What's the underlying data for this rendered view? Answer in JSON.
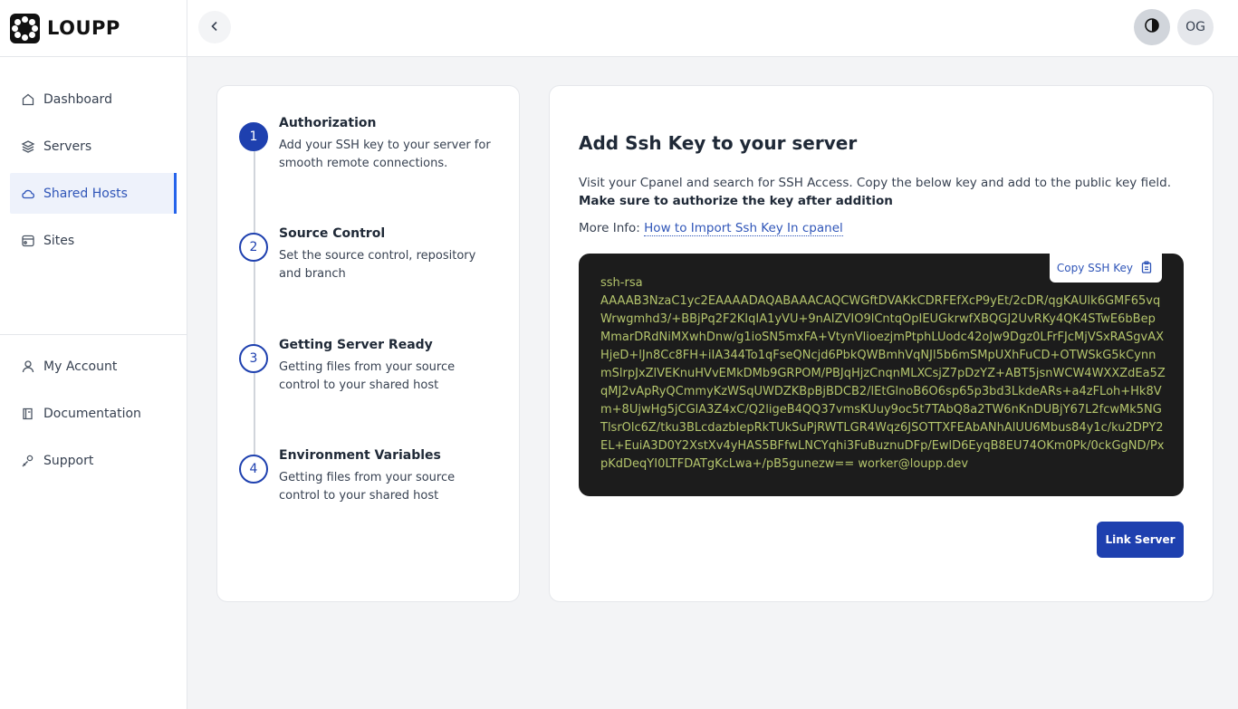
{
  "brand": {
    "name": "LOUPP"
  },
  "sidebar": {
    "items": [
      {
        "label": "Dashboard",
        "icon": "home-icon"
      },
      {
        "label": "Servers",
        "icon": "layers-icon"
      },
      {
        "label": "Shared Hosts",
        "icon": "cloud-icon",
        "active": true
      },
      {
        "label": "Sites",
        "icon": "site-icon"
      }
    ],
    "bottom_items": [
      {
        "label": "My Account",
        "icon": "user-icon"
      },
      {
        "label": "Documentation",
        "icon": "book-icon"
      },
      {
        "label": "Support",
        "icon": "support-icon"
      }
    ]
  },
  "topbar": {
    "avatar_initials": "OG"
  },
  "steps": [
    {
      "number": "1",
      "title": "Authorization",
      "description": "Add your SSH key to your server for smooth remote connections.",
      "active": true
    },
    {
      "number": "2",
      "title": "Source Control",
      "description": "Set the source control, repository and branch"
    },
    {
      "number": "3",
      "title": "Getting Server Ready",
      "description": "Getting files from your source control to your shared host"
    },
    {
      "number": "4",
      "title": "Environment Variables",
      "description": "Getting files from your source control to your shared host"
    }
  ],
  "main": {
    "heading": "Add Ssh Key to your server",
    "instructions": "Visit your Cpanel and search for SSH Access. Copy the below key and add to the public key field.",
    "instructions_bold": "Make sure to authorize the key after addition",
    "more_info_label": "More Info:",
    "more_info_link": "How to Import Ssh Key In cpanel",
    "copy_button": "Copy SSH Key",
    "key_type": "ssh-rsa",
    "key_value": "AAAAB3NzaC1yc2EAAAADAQABAAACAQCWGftDVAKkCDRFEfXcP9yEt/2cDR/qgKAUlk6GMF65vqWrwgmhd3/+BBjPq2F2KIqIA1yVU+9nAIZVIO9lCntqOpIEUGkrwfXBQGJ2UvRKy4QK4STwE6bBepMmarDRdNiMXwhDnw/g1ioSN5mxFA+VtynVlioezjmPtphLUodc42oJw9Dgz0LFrFJcMjVSxRASgvAXHjeD+lJn8Cc8FH+iIA344To1qFseQNcjd6PbkQWBmhVqNJl5b6mSMpUXhFuCD+OTWSkG5kCynnmSlrpJxZlVEKnuHVvEMkDMb9GRPOM/PBJqHjzCnqnMLXCsjZ7pDzYZ+ABT5jsnWCW4WXXZdEa5ZqMJ2vApRyQCmmyKzWSqUWDZKBpBjBDCB2/lEtGlnoB6O6sp65p3bd3LkdeARs+a4zFLoh+Hk8Vm+8UjwHg5jCGlA3Z4xC/Q2ligeB4QQ37vmsKUuy9oc5t7TAbQ8a2TW6nKnDUBjY67L2fcwMk5NGTlsrOlc6Z/tku3BLcdazbIepRkTUkSuPjRWTLGR4Wqz6JSOTTXFEAbANhAlUU6Mbus84y1c/ku2DPY2EL+EuiA3D0Y2XstXv4yHAS5BFfwLNCYqhi3FuBuznuDFp/EwlD6EyqB8EU74OKm0Pk/0ckGgND/PxpKdDeqYI0LTFDATgKcLwa+/pB5gunezw== worker@loupp.dev",
    "link_button": "Link Server"
  },
  "colors": {
    "accent": "#1e40af",
    "active_bg": "#eef2fb",
    "key_text": "#b4c56c",
    "key_bg": "#1c1c1c"
  }
}
